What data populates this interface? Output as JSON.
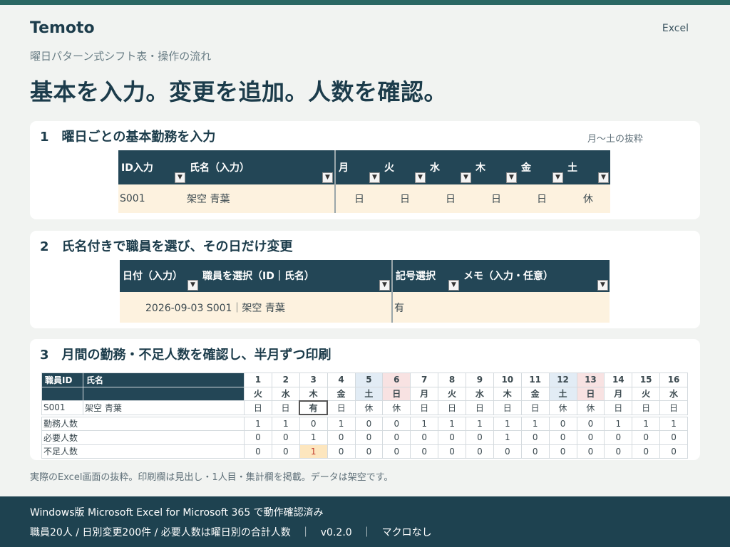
{
  "header": {
    "brand": "Temoto",
    "app": "Excel",
    "subtitle": "曜日パターン式シフト表・操作の流れ",
    "headline": "基本を入力。変更を追加。人数を確認。"
  },
  "step1": {
    "title": "1　曜日ごとの基本勤務を入力",
    "note": "月〜土の抜粋",
    "headers": [
      "ID入力",
      "氏名（入力）",
      "月",
      "火",
      "水",
      "木",
      "金",
      "土"
    ],
    "row": {
      "id": "S001",
      "name": "架空 青葉",
      "days": [
        "日",
        "日",
        "日",
        "日",
        "日",
        "休"
      ]
    }
  },
  "step2": {
    "title": "2　氏名付きで職員を選び、その日だけ変更",
    "headers": [
      "日付（入力）",
      "職員を選択（ID｜氏名）",
      "記号選択",
      "メモ（入力・任意）"
    ],
    "row": {
      "date_staff": "2026-09-03 S001｜架空 青葉",
      "symbol": "有",
      "memo": ""
    }
  },
  "step3": {
    "title": "3　月間の勤務・不足人数を確認し、半月ずつ印刷",
    "col_id": "職員ID",
    "col_name": "氏名",
    "dates": [
      "1",
      "2",
      "3",
      "4",
      "5",
      "6",
      "7",
      "8",
      "9",
      "10",
      "11",
      "12",
      "13",
      "14",
      "15",
      "16"
    ],
    "weekdays": [
      "火",
      "水",
      "木",
      "金",
      "土",
      "日",
      "月",
      "火",
      "水",
      "木",
      "金",
      "土",
      "日",
      "月",
      "火",
      "水"
    ],
    "staff": {
      "id": "S001",
      "name": "架空 青葉",
      "shifts": [
        "日",
        "日",
        "有",
        "日",
        "休",
        "休",
        "日",
        "日",
        "日",
        "日",
        "日",
        "休",
        "休",
        "日",
        "日",
        "日"
      ]
    },
    "summary": [
      {
        "label": "勤務人数",
        "values": [
          "1",
          "1",
          "0",
          "1",
          "0",
          "0",
          "1",
          "1",
          "1",
          "1",
          "1",
          "0",
          "0",
          "1",
          "1",
          "1"
        ]
      },
      {
        "label": "必要人数",
        "values": [
          "0",
          "0",
          "1",
          "0",
          "0",
          "0",
          "0",
          "0",
          "0",
          "1",
          "0",
          "0",
          "0",
          "0",
          "0",
          "0"
        ]
      },
      {
        "label": "不足人数",
        "values": [
          "0",
          "0",
          "1",
          "0",
          "0",
          "0",
          "0",
          "0",
          "0",
          "0",
          "0",
          "0",
          "0",
          "0",
          "0",
          "0"
        ]
      }
    ]
  },
  "footnote": "実際のExcel画面の抜粋。印刷欄は見出し・1人目・集計欄を掲載。データは架空です。",
  "footer": {
    "line1": "Windows版 Microsoft Excel for Microsoft 365 で動作確認済み",
    "line2": "職員20人 / 日別変更200件 / 必要人数は曜日別の合計人数　｜　v0.2.0　｜　マクロなし"
  },
  "colors": {
    "accent": "#2a6763",
    "header_fill": "#234656",
    "input_fill": "#fdf2df",
    "saturday": "#e2ecf5",
    "sunday": "#f8e2e2",
    "shortage": "#fde6be",
    "footer": "#1e4250"
  }
}
